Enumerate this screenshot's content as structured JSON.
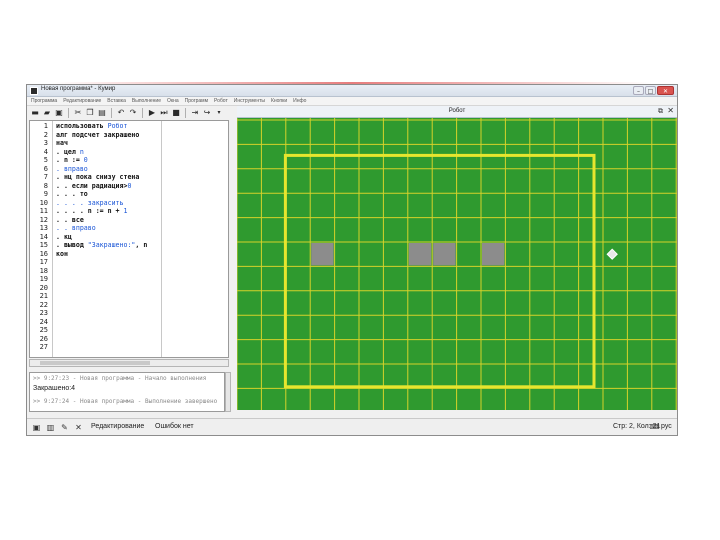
{
  "window": {
    "title": "Новая программа* - Кумир",
    "min_icon": "minimize-icon",
    "max_icon": "maximize-icon",
    "close_icon": "close-icon"
  },
  "menubar": {
    "items": [
      "Программа",
      "Редактирование",
      "Вставка",
      "Выполнение",
      "Окна",
      "Программ",
      "Робот",
      "Инструменты",
      "Кнопки",
      "Инфо"
    ]
  },
  "toolbar": {
    "icons": [
      "new-file-icon",
      "open-folder-icon",
      "save-icon",
      "cut-icon",
      "copy-icon",
      "paste-icon",
      "undo-icon",
      "redo-icon",
      "run-icon",
      "step-icon",
      "stop-icon",
      "step-into-icon",
      "step-over-icon"
    ]
  },
  "editor": {
    "line_numbers": [
      "1",
      "2",
      "3",
      "4",
      "5",
      "6",
      "7",
      "8",
      "9",
      "10",
      "11",
      "12",
      "13",
      "14",
      "15",
      "16",
      "17",
      "18",
      "19",
      "20",
      "21",
      "22",
      "23",
      "24",
      "25",
      "26",
      "27"
    ],
    "code": [
      [
        {
          "t": "использовать ",
          "c": "kw"
        },
        {
          "t": "Робот",
          "c": "blue"
        }
      ],
      [
        {
          "t": "алг подсчет закрашено",
          "c": "kw"
        }
      ],
      [
        {
          "t": "нач",
          "c": "kw"
        }
      ],
      [
        {
          "t": ". цел ",
          "c": "kw"
        },
        {
          "t": "n",
          "c": "blue"
        }
      ],
      [
        {
          "t": ". n := ",
          "c": "kw"
        },
        {
          "t": "0",
          "c": "blue"
        }
      ],
      [
        {
          "t": ". вправо",
          "c": "blue"
        }
      ],
      [
        {
          "t": ". нц пока снизу стена",
          "c": "kw"
        }
      ],
      [
        {
          "t": ". . если радиация>",
          "c": "kw"
        },
        {
          "t": "0",
          "c": "blue"
        }
      ],
      [
        {
          "t": ". . . то",
          "c": "kw"
        }
      ],
      [
        {
          "t": ". . . . закрасить",
          "c": "blue"
        }
      ],
      [
        {
          "t": ". . . . n := n + ",
          "c": "kw"
        },
        {
          "t": "1",
          "c": "blue"
        }
      ],
      [
        {
          "t": ". . все",
          "c": "kw"
        }
      ],
      [
        {
          "t": ". . вправо",
          "c": "blue"
        }
      ],
      [
        {
          "t": ". кц",
          "c": "kw"
        }
      ],
      [
        {
          "t": ". вывод ",
          "c": "kw"
        },
        {
          "t": "\"Закрашено:\"",
          "c": "blue"
        },
        {
          "t": ", n",
          "c": "kw"
        }
      ],
      [
        {
          "t": "кон",
          "c": "kw"
        }
      ]
    ]
  },
  "output": {
    "lines": [
      ">> 9:27:23 - Новая программа - Начало выполнения",
      "Закрашено:4",
      ">> 9:27:24 - Новая программа - Выполнение завершено"
    ]
  },
  "statusbar": {
    "icons": [
      "editor-mode-icon",
      "save-status-icon",
      "debug-icon",
      "tools-icon"
    ],
    "mode": "Редактирование",
    "errors": "Ошибок нет",
    "position": "Стр: 2, Кол: 21",
    "lang": "рус",
    "lang_icon": "keyboard-icon"
  },
  "robot": {
    "title": "Робот",
    "restore_icon": "restore-icon",
    "close_icon": "close-icon",
    "field": {
      "background": "#2f9a2f",
      "grid_color": "#d6d22a",
      "wall_color": "#e6e62e",
      "painted_color": "#8c8c8c",
      "cols": 14,
      "rows": 11,
      "walls_rect": {
        "col_start": 1,
        "row_start": 1,
        "col_end": 15,
        "row_end": 12
      },
      "painted_cells": [
        [
          3,
          5
        ],
        [
          7,
          5
        ],
        [
          8,
          5
        ],
        [
          10,
          5
        ]
      ],
      "robot_cell": [
        15,
        5
      ]
    }
  }
}
